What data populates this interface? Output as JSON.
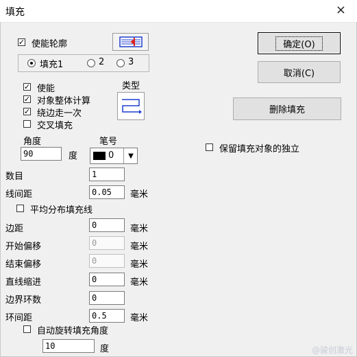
{
  "window": {
    "title": "填充",
    "close_glyph": "×"
  },
  "buttons": {
    "ok": "确定(O)",
    "cancel": "取消(C)",
    "delete_fill": "删除填充"
  },
  "contour": {
    "label": "使能轮廓",
    "checked": true
  },
  "fill_select": {
    "options": [
      "填充1",
      "2",
      "3"
    ],
    "selected": 0
  },
  "options": [
    {
      "label": "使能",
      "checked": true
    },
    {
      "label": "对象整体计算",
      "checked": true
    },
    {
      "label": "绕边走一次",
      "checked": true
    },
    {
      "label": "交叉填充",
      "checked": false
    }
  ],
  "type_label": "类型",
  "angle": {
    "label": "角度",
    "value": "90",
    "unit": "度"
  },
  "pen": {
    "label": "笔号",
    "value": "0",
    "color": "#000000"
  },
  "keep_independent": {
    "label": "保留填充对象的独立",
    "checked": false
  },
  "count": {
    "label": "数目",
    "value": "1"
  },
  "line_spacing": {
    "label": "线间距",
    "value": "0.05",
    "unit": "毫米"
  },
  "avg_distribute": {
    "label": "平均分布填充线",
    "checked": false
  },
  "margin": {
    "label": "边距",
    "value": "0",
    "unit": "毫米"
  },
  "start_offset": {
    "label": "开始偏移",
    "value": "0",
    "unit": "毫米"
  },
  "end_offset": {
    "label": "结束偏移",
    "value": "0",
    "unit": "毫米"
  },
  "line_indent": {
    "label": "直线缩进",
    "value": "0",
    "unit": "毫米"
  },
  "border_loops": {
    "label": "边界环数",
    "value": "0"
  },
  "loop_spacing": {
    "label": "环间距",
    "value": "0.5",
    "unit": "毫米"
  },
  "auto_rotate": {
    "label": "自动旋转填充角度",
    "checked": false,
    "value": "10",
    "unit": "度"
  },
  "watermark": "@骏创激光",
  "colors": {
    "icon_blue": "#1f3fd0",
    "icon_red": "#e0201a",
    "bg": "#f0f0f0"
  }
}
